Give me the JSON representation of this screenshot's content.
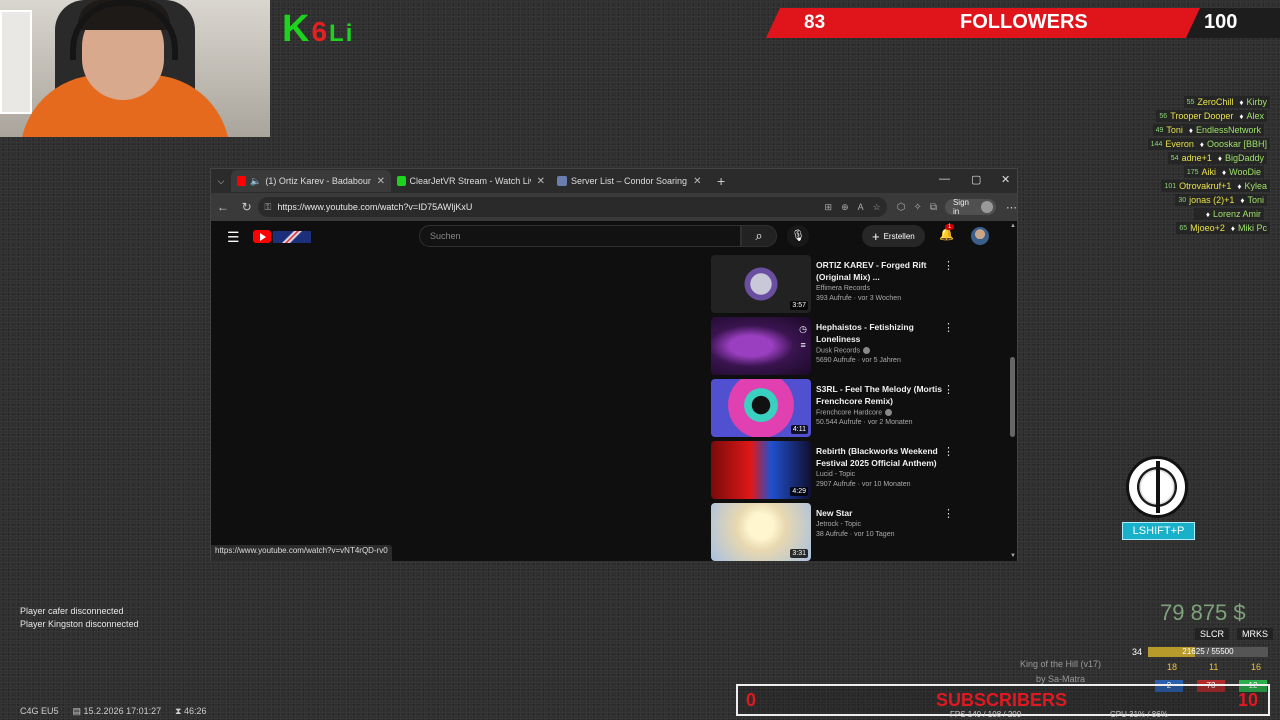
{
  "overlay": {
    "logo": {
      "k": "K",
      "n": "6",
      "u": "Li"
    },
    "followers": {
      "current": "83",
      "label": "FOLLOWERS",
      "goal": "100"
    },
    "players": [
      {
        "n": "55",
        "left": "ZeroChill",
        "right": "Kirby"
      },
      {
        "n": "56",
        "left": "Trooper Dooper",
        "right": "Alex"
      },
      {
        "n": "49",
        "left": "Toni",
        "right": "EndlessNetwork"
      },
      {
        "n": "144",
        "left": "Everon",
        "right": "Oooskar [BBH]"
      },
      {
        "n": "54",
        "left": "adne+1",
        "right": "BigDaddy"
      },
      {
        "n": "175",
        "left": "Aiki",
        "right": "WooDie"
      },
      {
        "n": "101",
        "left": "Otrovakruf+1",
        "right": "Kylea"
      },
      {
        "n": "30",
        "left": "jonas (2)+1",
        "right": "Toni"
      },
      {
        "n": "",
        "left": "",
        "right": "Lorenz Amir"
      },
      {
        "n": "65",
        "left": "Mjoeo+2",
        "right": "Miki Pc"
      }
    ],
    "lshift": "LSHIFT+P",
    "chat": [
      "Player cafer disconnected",
      "Player Kingston disconnected"
    ],
    "money": "79 875 $",
    "slcr": "SLCR",
    "mrks": "MRKS",
    "level": "34",
    "xp": "21625 / 55500",
    "xp_fraction": 0.39,
    "koth_title": "King of the Hill (v17)",
    "koth_by": "by Sa-Matra",
    "stats": [
      "18",
      "11",
      "16",
      "2",
      "73",
      "12"
    ],
    "subscribers": {
      "current": "0",
      "label": "SUBSCRIBERS",
      "goal": "10"
    },
    "fps": "FPS 140 / 108 / 200",
    "cpu": "CPU 31% / 86%",
    "bottom": {
      "server": "C4G EU5",
      "datetime": "15.2.2026 17:01:27",
      "timer": "46:26"
    }
  },
  "browser": {
    "tabs": [
      {
        "label": "(1) Ortiz Karev - Badaboum (",
        "color": "#ff0000"
      },
      {
        "label": "ClearJetVR Stream - Watch Live on",
        "color": "#1ed31e"
      },
      {
        "label": "Server List – Condor Soaring",
        "color": "#6a7fb0"
      }
    ],
    "url": "https://www.youtube.com/watch?v=ID75AWljKxU",
    "signin": "Sign in",
    "status_url": "https://www.youtube.com/watch?v=vNT4rQD-rv0"
  },
  "youtube": {
    "search_placeholder": "Suchen",
    "create": "Erstellen",
    "notif_count": "1",
    "videos": [
      {
        "title": "ORTIZ KAREV - Forged Rift (Original Mix) ...",
        "channel": "Effimera Records",
        "stats": "393 Aufrufe · vor 3 Wochen",
        "duration": "3:57",
        "thumb": "radial-gradient(circle at 50% 50%,#c8c8d8 0 18%,#6a4fa0 19% 28%,#222 29% 100%)"
      },
      {
        "title": "Hephaistos - Fetishizing Loneliness",
        "channel": "Dusk Records",
        "stats": "5690 Aufrufe · vor 5 Jahren",
        "duration": "",
        "thumb": "radial-gradient(ellipse at 40% 50%,#9a3fc0 0 25%,#3a1450 50%,#1a0a25 100%)"
      },
      {
        "title": "S3RL - Feel The Melody (Mortis Frenchcore Remix)",
        "channel": "Frenchcore Hardcore",
        "stats": "50.544 Aufrufe · vor 2 Monaten",
        "duration": "4:11",
        "thumb": "radial-gradient(circle at 50% 45%,#111 0 15%,#3ad0c0 16% 28%,#e040b0 29% 55%,#5050d0 56% 100%)"
      },
      {
        "title": "Rebirth (Blackworks Weekend Festival 2025 Official Anthem)",
        "channel": "Lucid - Topic",
        "stats": "2907 Aufrufe · vor 10 Monaten",
        "duration": "4:29",
        "thumb": "linear-gradient(90deg,#7a0a0a 0%,#e01818 40%,#2050d0 60%,#101030 100%)"
      },
      {
        "title": "New Star",
        "channel": "Jetrock - Topic",
        "stats": "38 Aufrufe · vor 10 Tagen",
        "duration": "3:31",
        "thumb": "radial-gradient(circle at 50% 40%,#fff6d0 0 20%,#e8d8b0 40%,#a8c0e0 100%)"
      }
    ]
  }
}
